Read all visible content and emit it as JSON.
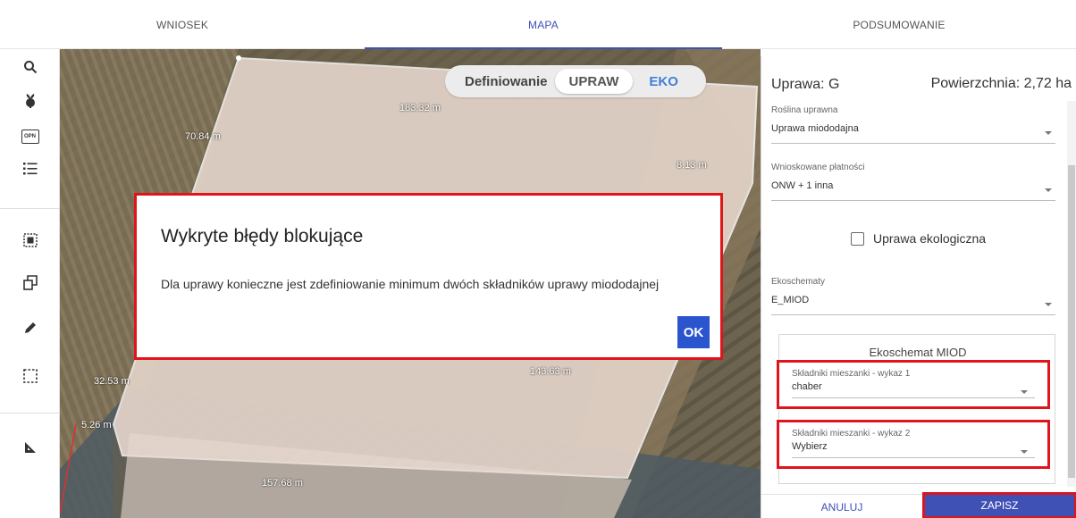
{
  "tabs": [
    {
      "label": "WNIOSEK"
    },
    {
      "label": "MAPA"
    },
    {
      "label": "PODSUMOWANIE"
    }
  ],
  "active_tab": "MAPA",
  "accent_color": "#3f51b5",
  "left_toolbar": {
    "icons": [
      "search-icon",
      "plant-icon",
      "opn-icon",
      "list-icon",
      "select-area-icon",
      "copy-icon",
      "pencil-icon",
      "selection-icon",
      "measure-icon"
    ],
    "opn_label": "OPN"
  },
  "map": {
    "mode_label": "Definiowanie",
    "mode_active": "UPRAW",
    "mode_other": "EKO",
    "measures": {
      "m1": "183.32 m",
      "m2": "70.84 m",
      "m3": "8.13 m",
      "m4": "32.53 m",
      "m5": "143.63 m",
      "m6": "5.26 m",
      "m7": "157.68 m"
    }
  },
  "modal": {
    "title": "Wykryte błędy blokujące",
    "message": "Dla uprawy konieczne jest zdefiniowanie minimum dwóch składników uprawy miododajnej",
    "ok_label": "OK",
    "border_color": "#e0141b"
  },
  "panel": {
    "title": "Uprawa: G",
    "area": "Powierzchnia: 2,72 ha",
    "plant_label": "Roślina uprawna",
    "plant_value": "Uprawa miododajna",
    "payments_label": "Wnioskowane płatności",
    "payments_value": "ONW + 1 inna",
    "eco_checkbox_label": "Uprawa ekologiczna",
    "ecoschemes_label": "Ekoschematy",
    "ecoschemes_value": "E_MIOD",
    "eko_section_title": "Ekoschemat MIOD",
    "mix1_label": "Składniki mieszanki - wykaz 1",
    "mix1_value": "chaber",
    "mix2_label": "Składniki mieszanki - wykaz 2",
    "mix2_value": "Wybierz",
    "cancel_label": "ANULUJ",
    "save_label": "ZAPISZ"
  }
}
